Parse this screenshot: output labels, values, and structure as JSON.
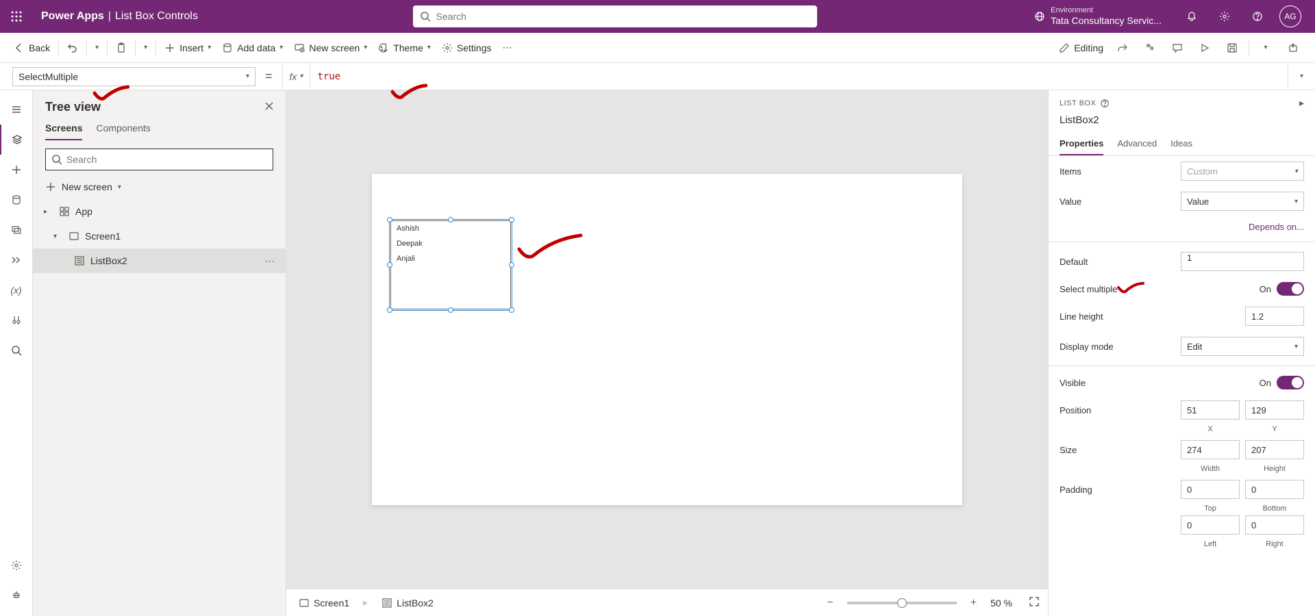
{
  "header": {
    "app": "Power Apps",
    "page": "List Box Controls",
    "search_placeholder": "Search",
    "env_label": "Environment",
    "env_value": "Tata Consultancy Servic...",
    "avatar": "AG"
  },
  "cmdbar": {
    "back": "Back",
    "insert": "Insert",
    "add_data": "Add data",
    "new_screen": "New screen",
    "theme": "Theme",
    "settings": "Settings",
    "editing": "Editing"
  },
  "fxbar": {
    "property": "SelectMultiple",
    "fx": "fx",
    "formula": "true"
  },
  "tree": {
    "title": "Tree view",
    "tabs": {
      "screens": "Screens",
      "components": "Components"
    },
    "search_placeholder": "Search",
    "new_screen": "New screen",
    "app": "App",
    "screen1": "Screen1",
    "listbox2": "ListBox2"
  },
  "canvas": {
    "items": [
      "Ashish",
      "Deepak",
      "Anjali"
    ],
    "crumb_screen": "Screen1",
    "crumb_control": "ListBox2",
    "zoom": "50  %"
  },
  "props": {
    "type": "LIST BOX",
    "name": "ListBox2",
    "tabs": {
      "properties": "Properties",
      "advanced": "Advanced",
      "ideas": "Ideas"
    },
    "items_label": "Items",
    "items_placeholder": "Custom",
    "value_label": "Value",
    "value": "Value",
    "depends": "Depends on...",
    "default_label": "Default",
    "default": "1",
    "selmul_label": "Select multiple",
    "on": "On",
    "lineheight_label": "Line height",
    "lineheight": "1.2",
    "dispmode_label": "Display mode",
    "dispmode": "Edit",
    "visible_label": "Visible",
    "position_label": "Position",
    "x": "51",
    "y": "129",
    "xl": "X",
    "yl": "Y",
    "size_label": "Size",
    "w": "274",
    "h": "207",
    "wl": "Width",
    "hl": "Height",
    "padding_label": "Padding",
    "pt": "0",
    "pb": "0",
    "pl": "0",
    "pr": "0",
    "tl": "Top",
    "bl": "Bottom",
    "ll": "Left",
    "rl": "Right"
  }
}
